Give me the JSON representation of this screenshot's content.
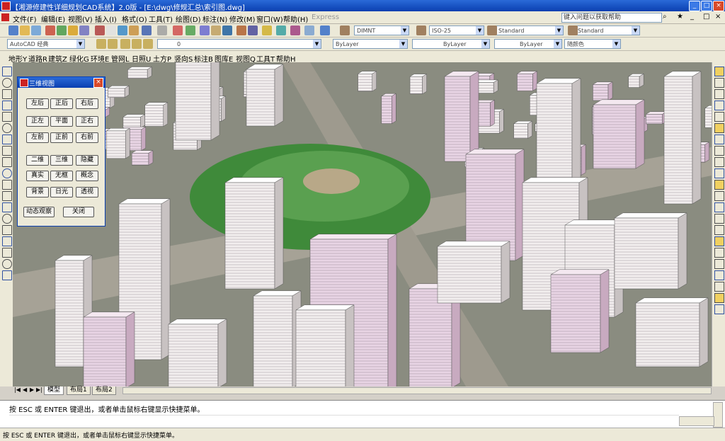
{
  "window": {
    "title": "【湘源修建性详细规划CAD系统】2.0版 - [E:\\dwg\\修规汇总\\索引图.dwg]",
    "controls": [
      "_",
      "□",
      "×"
    ]
  },
  "menubar": {
    "items": [
      "文件(F)",
      "编辑(E)",
      "视图(V)",
      "插入(I)",
      "格式(O)",
      "工具(T)",
      "绘图(D)",
      "标注(N)",
      "修改(M)",
      "窗口(W)",
      "帮助(H)",
      "Express"
    ],
    "ask_placeholder": "键入问题以获取帮助"
  },
  "toolbar1": {
    "text_style": "DIMNT",
    "dim_style": "ISO-25",
    "table_style": "Standard",
    "multileader_style": "Standard"
  },
  "toolbar2": {
    "workspace": "AutoCAD 经典",
    "layer": "0",
    "color": "ByLayer",
    "linetype": "ByLayer",
    "lineweight": "ByLayer",
    "plotstyle": "随颜色"
  },
  "menubar2": {
    "items": [
      "地形Y",
      "道路R",
      "建筑Z",
      "绿化G",
      "环境E",
      "管网L",
      "日照U",
      "土方P",
      "竖向S",
      "标注B",
      "图库E",
      "视图Q",
      "工具T",
      "帮助H"
    ]
  },
  "dialog": {
    "title": "三维视图",
    "close": "×",
    "rows": [
      [
        "左后",
        "正后",
        "右后"
      ],
      [
        "正左",
        "平面",
        "正右"
      ],
      [
        "左前",
        "正前",
        "右前"
      ],
      [
        "二维",
        "三维",
        "隐藏"
      ],
      [
        "真实",
        "无框",
        "概念"
      ],
      [
        "背景",
        "日光",
        "透视"
      ]
    ],
    "bottom": [
      "动态观察",
      "关闭"
    ]
  },
  "tabs": {
    "items": [
      "模型",
      "布局1",
      "布局2"
    ],
    "nav": [
      "|◀",
      "◀",
      "▶",
      "▶|"
    ]
  },
  "command": {
    "line1": "按 ESC 或 ENTER 键退出，或者单击鼠标右键显示快捷菜单。"
  },
  "status": {
    "text": "按 ESC 或 ENTER 键退出，或者单击鼠标右键显示快捷菜单。"
  },
  "colors": {
    "titlebar": "#0a3fb0",
    "chrome": "#ece9d8",
    "building_pink": "#e8d4e4",
    "building_white": "#f2eeee",
    "park_green": "#3f8a3a"
  }
}
